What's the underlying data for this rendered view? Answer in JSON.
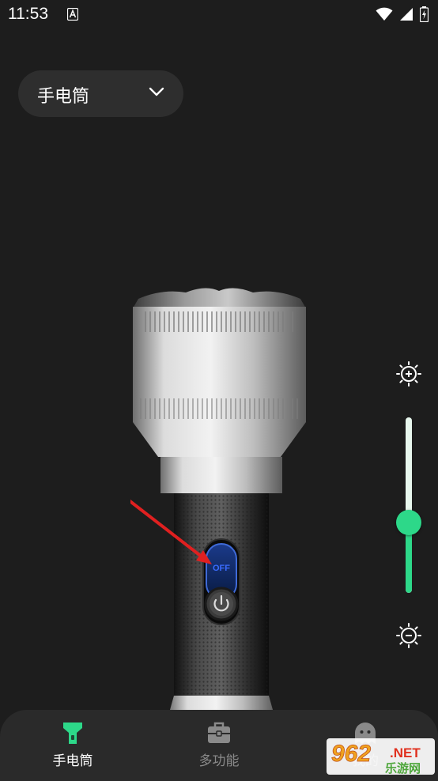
{
  "status_bar": {
    "time": "11:53"
  },
  "mode_selector": {
    "label": "手电筒"
  },
  "flashlight": {
    "switch_label": "OFF"
  },
  "brightness": {
    "level": 0.4
  },
  "bottom_nav": {
    "items": [
      {
        "label": "手电筒",
        "active": true
      },
      {
        "label": "多功能",
        "active": false
      },
      {
        "label": "我的",
        "active": false
      }
    ]
  },
  "watermark": {
    "number": "962",
    "suffix": ".NET",
    "text": "乐游网"
  },
  "colors": {
    "accent": "#2dd889",
    "background": "#1d1d1d",
    "annotation_arrow": "#e02020"
  }
}
